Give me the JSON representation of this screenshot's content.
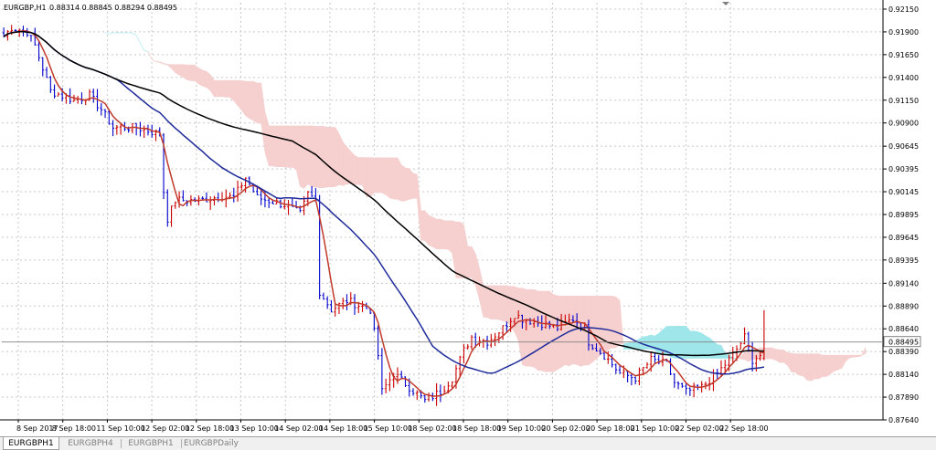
{
  "window": {
    "symbol_label": "EURGBP,H1",
    "ohlc_text": "0.88314 0.88845 0.88294 0.88495"
  },
  "tabs": [
    {
      "label": "EURGBPH1",
      "active": true
    },
    {
      "label": "EURGBPH4",
      "active": false
    },
    {
      "label": "EURGBPH1",
      "active": false
    },
    {
      "label": "EURGBPDaily",
      "active": false
    }
  ],
  "chart_data": {
    "type": "candlestick",
    "ylim": [
      0.8764,
      0.9222
    ],
    "y_ticks": [
      "0.92150",
      "0.91900",
      "0.91650",
      "0.91400",
      "0.91150",
      "0.90900",
      "0.90645",
      "0.90395",
      "0.90145",
      "0.89895",
      "0.89645",
      "0.89395",
      "0.89140",
      "0.88890",
      "0.88640",
      "0.88390",
      "0.88140",
      "0.87890",
      "0.87640"
    ],
    "y_tick_values": [
      0.9215,
      0.919,
      0.9165,
      0.914,
      0.9115,
      0.909,
      0.90645,
      0.90395,
      0.90145,
      0.89895,
      0.89645,
      0.89395,
      0.8914,
      0.8889,
      0.8864,
      0.8839,
      0.8814,
      0.8789,
      0.8764
    ],
    "x_ticks": [
      "8 Sep 2017",
      "8 Sep 18:00",
      "11 Sep 10:00",
      "12 Sep 02:00",
      "12 Sep 18:00",
      "13 Sep 10:00",
      "14 Sep 02:00",
      "14 Sep 18:00",
      "15 Sep 10:00",
      "18 Sep 02:00",
      "18 Sep 18:00",
      "19 Sep 10:00",
      "20 Sep 02:00",
      "20 Sep 18:00",
      "21 Sep 10:00",
      "22 Sep 02:00",
      "22 Sep 18:00"
    ],
    "current_price": "0.88495",
    "current_price_value": 0.88495,
    "bar_count": 196,
    "ichimoku_offset": 26,
    "control_points": [
      [
        0,
        0.9185
      ],
      [
        2,
        0.9195
      ],
      [
        6,
        0.919
      ],
      [
        8,
        0.9175
      ],
      [
        10,
        0.915
      ],
      [
        12,
        0.9125
      ],
      [
        18,
        0.9115
      ],
      [
        22,
        0.912
      ],
      [
        25,
        0.9105
      ],
      [
        28,
        0.9085
      ],
      [
        34,
        0.9085
      ],
      [
        40,
        0.9078
      ],
      [
        41,
        0.9015
      ],
      [
        42,
        0.8985
      ],
      [
        44,
        0.9005
      ],
      [
        50,
        0.9005
      ],
      [
        56,
        0.901
      ],
      [
        59,
        0.9008
      ],
      [
        62,
        0.903
      ],
      [
        65,
        0.9008
      ],
      [
        72,
        0.9
      ],
      [
        76,
        0.899
      ],
      [
        78,
        0.9012
      ],
      [
        80,
        0.9005
      ],
      [
        81,
        0.8905
      ],
      [
        84,
        0.8885
      ],
      [
        88,
        0.8895
      ],
      [
        94,
        0.8885
      ],
      [
        96,
        0.8835
      ],
      [
        97,
        0.8795
      ],
      [
        100,
        0.8815
      ],
      [
        104,
        0.88
      ],
      [
        108,
        0.8785
      ],
      [
        112,
        0.8795
      ],
      [
        115,
        0.881
      ],
      [
        118,
        0.884
      ],
      [
        120,
        0.8855
      ],
      [
        124,
        0.885
      ],
      [
        128,
        0.8865
      ],
      [
        131,
        0.888
      ],
      [
        133,
        0.8875
      ],
      [
        138,
        0.887
      ],
      [
        142,
        0.8865
      ],
      [
        146,
        0.8875
      ],
      [
        149,
        0.8865
      ],
      [
        150,
        0.885
      ],
      [
        154,
        0.8835
      ],
      [
        158,
        0.8815
      ],
      [
        162,
        0.881
      ],
      [
        166,
        0.883
      ],
      [
        170,
        0.8825
      ],
      [
        172,
        0.8805
      ],
      [
        175,
        0.8795
      ],
      [
        179,
        0.88
      ],
      [
        183,
        0.8815
      ],
      [
        187,
        0.8835
      ],
      [
        190,
        0.8855
      ],
      [
        192,
        0.883
      ],
      [
        194,
        0.8835
      ],
      [
        195,
        0.88495
      ]
    ],
    "series": [
      {
        "kind": "ohlc-bars",
        "color_up": "#cc0000",
        "color_down": "#0000cc"
      },
      {
        "kind": "moving-average",
        "period": 5,
        "color": "#c0392b"
      },
      {
        "kind": "moving-average",
        "period": 30,
        "color": "#1f2a9a"
      },
      {
        "kind": "moving-average",
        "period": 75,
        "color": "#000000"
      },
      {
        "kind": "ichimoku-cloud",
        "color_bull": "#9fe6ea",
        "color_bear": "#f6cfcf"
      }
    ],
    "grid": true,
    "colors": {
      "background": "#ffffff",
      "grid": "#c8c8c8",
      "axis": "#000000",
      "current_line": "#808080"
    }
  }
}
